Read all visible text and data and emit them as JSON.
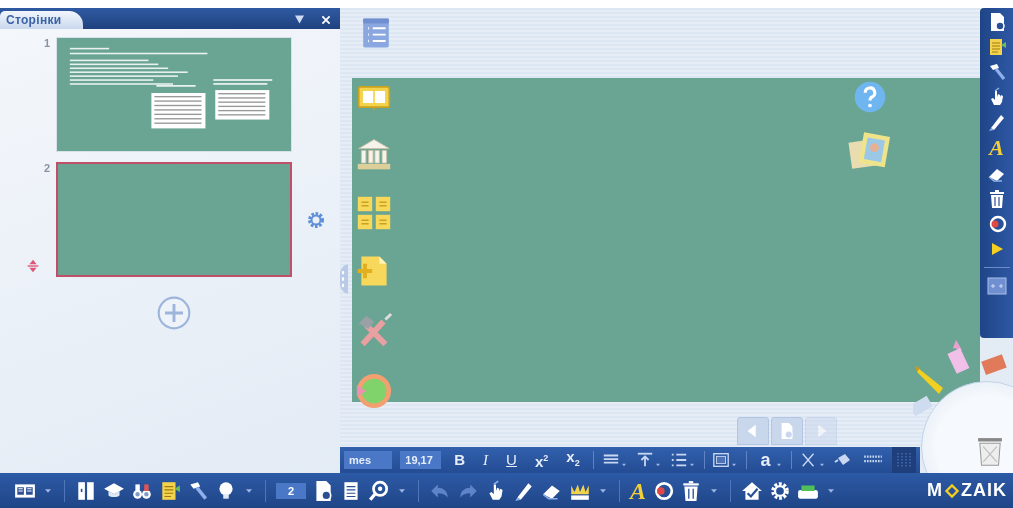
{
  "pages_panel": {
    "title": "Сторінки",
    "pages": [
      {
        "number": "1",
        "selected": false,
        "kind": "content"
      },
      {
        "number": "2",
        "selected": true,
        "kind": "blank"
      }
    ]
  },
  "format_bar": {
    "font": "mes",
    "size": "19,17",
    "buttons": [
      {
        "label": "B",
        "kind": "bold"
      },
      {
        "label": "I",
        "kind": "italic"
      },
      {
        "label": "U",
        "kind": "underline"
      },
      {
        "label": "x$^{2}$",
        "kind": "script"
      },
      {
        "label": "x$_{2}$",
        "kind": "script"
      }
    ],
    "text_color": "a"
  },
  "side_toolbar": {
    "text_tool": "A"
  },
  "bottom_bar": {
    "page_number": "2",
    "text_tool": "A",
    "logo_left": "M",
    "logo_right": "ZAIK"
  }
}
